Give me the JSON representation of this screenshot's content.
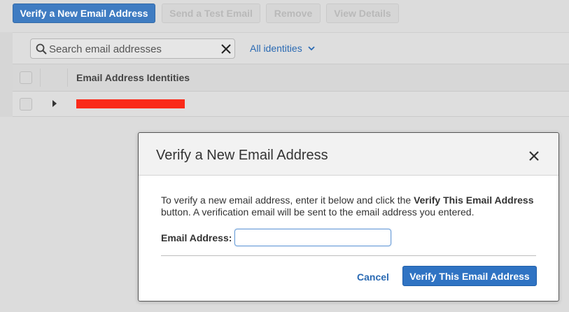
{
  "toolbar": {
    "verify_new": "Verify a New Email Address",
    "send_test": "Send a Test Email",
    "remove": "Remove",
    "view_details": "View Details"
  },
  "search": {
    "placeholder": "Search email addresses"
  },
  "filter": {
    "label": "All identities"
  },
  "table": {
    "column_header": "Email Address Identities"
  },
  "modal": {
    "title": "Verify a New Email Address",
    "desc_part1": "To verify a new email address, enter it below and click the ",
    "desc_bold": "Verify This Email Address",
    "desc_part2": " button. A verification email will be sent to the email address you entered.",
    "field_label": "Email Address:",
    "field_value": "",
    "cancel": "Cancel",
    "submit": "Verify This Email Address"
  },
  "colors": {
    "primary": "#2f73c3",
    "link": "#2a6ab3",
    "redaction": "#fa2a19"
  }
}
